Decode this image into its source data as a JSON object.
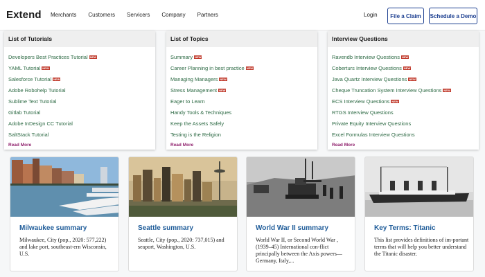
{
  "header": {
    "logo": "Extend",
    "nav": [
      "Merchants",
      "Customers",
      "Servicers",
      "Company",
      "Partners"
    ],
    "login": "Login",
    "file_claim": "File a Claim",
    "schedule_demo": "Schedule a Demo"
  },
  "badge_text": "NEW",
  "panels": [
    {
      "title": "List of Tutorials",
      "items": [
        {
          "label": "Developers Best Practices Tutorial",
          "badge": true
        },
        {
          "label": "YAML Tutorial",
          "badge": true
        },
        {
          "label": "Salesforce Tutorial",
          "badge": true
        },
        {
          "label": "Adobe Robohelp Tutorial",
          "badge": false
        },
        {
          "label": "Sublime Text Tutorial",
          "badge": false
        },
        {
          "label": "Gitlab Tutorial",
          "badge": false
        },
        {
          "label": "Adobe InDesign CC Tutorial",
          "badge": false
        },
        {
          "label": "SaltStack Tutorial",
          "badge": false
        }
      ],
      "read_more": "Read More"
    },
    {
      "title": "List of Topics",
      "items": [
        {
          "label": "Summary",
          "badge": true
        },
        {
          "label": "Career Planning in best practice",
          "badge": true
        },
        {
          "label": "Managing Managers",
          "badge": true
        },
        {
          "label": "Stress Management",
          "badge": true
        },
        {
          "label": "Eager to Learn",
          "badge": false
        },
        {
          "label": "Handy Tools & Techniques",
          "badge": false
        },
        {
          "label": "Keep the Assets Safely",
          "badge": false
        },
        {
          "label": "Testing is the Religion",
          "badge": false
        }
      ],
      "read_more": "Read More"
    },
    {
      "title": "Interview Questions",
      "items": [
        {
          "label": "Ravendb Interview Questions",
          "badge": true
        },
        {
          "label": "Coberturs Interview Questions",
          "badge": true
        },
        {
          "label": "Java Quartz Interview Questions",
          "badge": true
        },
        {
          "label": "Cheque Truncation System Interview Questions",
          "badge": true
        },
        {
          "label": "ECS Interview Questions",
          "badge": true
        },
        {
          "label": "RTGS Interview Questions",
          "badge": false
        },
        {
          "label": "Private Equity Interview Questions",
          "badge": false
        },
        {
          "label": "Excel Formulas Interview Questions",
          "badge": false
        }
      ],
      "read_more": "Read More"
    }
  ],
  "cards": [
    {
      "title": "Milwaukee summary",
      "text": "Milwaukee, City (pop., 2020: 577,222) and lake port, southeast-ern Wisconsin, U.S.",
      "image": "milwaukee-harbor-photo"
    },
    {
      "title": "Seattle summary",
      "text": "Seattle, City (pop., 2020: 737,015) and seaport, Washington, U.S.",
      "image": "seattle-skyline-photo"
    },
    {
      "title": "World War II summary",
      "text": "World War II, or Second World War , (1939–45) International con-flict principally between the Axis powers—Germany, Italy,...",
      "image": "ww2-tanks-photo"
    },
    {
      "title": "Key Terms: Titanic",
      "text": "This list provides definitions of im-portant terms that will help you better understand the Titanic disaster.",
      "image": "titanic-ship-photo"
    }
  ],
  "colors": {
    "brand": "#1a3d8f",
    "link_green": "#2d6a44",
    "read_more": "#8e1e6b",
    "card_title": "#1f5c99",
    "badge": "#c0392b"
  }
}
